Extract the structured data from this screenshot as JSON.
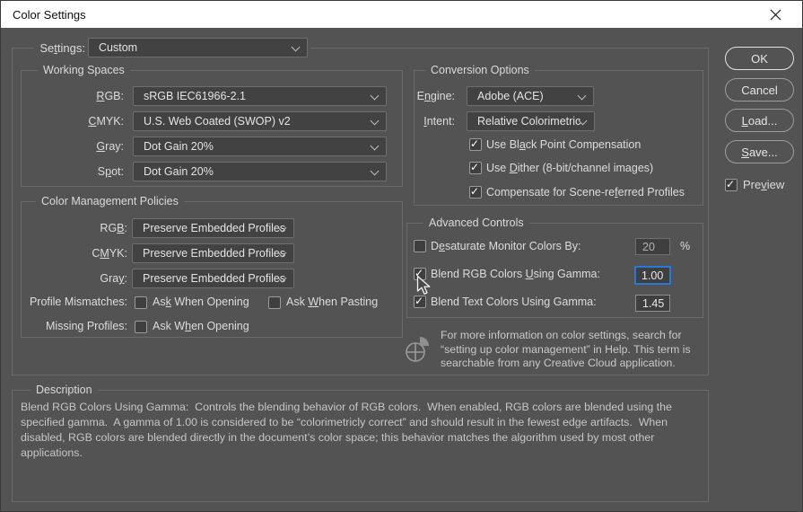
{
  "icons": {
    "check": "✓"
  },
  "colors": {
    "dialog_bg": "#535353",
    "titlebar_bg": "#ffffff",
    "control_bg": "#424242",
    "group_border": "#6a6a6a",
    "focus_accent": "#2878d8",
    "text": "#dcdcdc"
  },
  "window": {
    "title": "Color Settings"
  },
  "settings": {
    "label": {
      "pre": "Se",
      "u": "t",
      "post": "tings:"
    },
    "value": "Custom"
  },
  "working_spaces": {
    "title": "Working Spaces",
    "rows": [
      {
        "label": {
          "pre": "",
          "u": "R",
          "post": "GB:"
        },
        "value": "sRGB IEC61966-2.1"
      },
      {
        "label": {
          "pre": "",
          "u": "C",
          "post": "MYK:"
        },
        "value": "U.S. Web Coated (SWOP) v2"
      },
      {
        "label": {
          "pre": "",
          "u": "G",
          "post": "ray:"
        },
        "value": "Dot Gain 20%"
      },
      {
        "label": {
          "pre": "S",
          "u": "p",
          "post": "ot:"
        },
        "value": "Dot Gain 20%"
      }
    ]
  },
  "policies": {
    "title": "Color Management Policies",
    "rows": [
      {
        "label": {
          "pre": "RG",
          "u": "B",
          "post": ":"
        },
        "value": "Preserve Embedded Profiles"
      },
      {
        "label": {
          "pre": "C",
          "u": "M",
          "post": "YK:"
        },
        "value": "Preserve Embedded Profiles"
      },
      {
        "label": {
          "pre": "Gra",
          "u": "y",
          "post": ":"
        },
        "value": "Preserve Embedded Profiles"
      }
    ],
    "profile_mismatches_label": "Profile Mismatches:",
    "missing_profiles_label": "Missing Profiles:",
    "ask_opening": {
      "pre": "As",
      "u": "k",
      "post": " When Opening",
      "checked": false
    },
    "ask_pasting": {
      "pre": "Ask ",
      "u": "W",
      "post": "hen Pasting",
      "checked": false
    },
    "ask_opening2": {
      "pre": "Ask W",
      "u": "h",
      "post": "en Opening",
      "checked": false
    }
  },
  "conversion": {
    "title": "Conversion Options",
    "engine": {
      "label": {
        "pre": "E",
        "u": "n",
        "post": "gine:"
      },
      "value": "Adobe (ACE)"
    },
    "intent": {
      "label": {
        "pre": "",
        "u": "I",
        "post": "ntent:"
      },
      "value": "Relative Colorimetric"
    },
    "checks": [
      {
        "pre": "Use Bl",
        "u": "a",
        "post": "ck Point Compensation",
        "checked": true
      },
      {
        "pre": "Use ",
        "u": "D",
        "post": "ither (8-bit/channel images)",
        "checked": true
      },
      {
        "pre": "Compensate for Scene-re",
        "u": "f",
        "post": "erred Profiles",
        "checked": true
      }
    ]
  },
  "advanced": {
    "title": "Advanced Controls",
    "rows": [
      {
        "pre": "D",
        "u": "e",
        "post": "saturate Monitor Colors By:",
        "checked": false,
        "value": "20",
        "suffix": "%"
      },
      {
        "pre": "Blend RGB Colors ",
        "u": "U",
        "post": "sing Gamma:",
        "checked": true,
        "value": "1.00"
      },
      {
        "pre": "Blend Text Colors Using Gamma:",
        "u": "",
        "post": "",
        "checked": true,
        "value": "1.45"
      }
    ]
  },
  "info": {
    "text": "For more information on color settings, search for “setting up color management” in Help. This term is searchable from any Creative Cloud application."
  },
  "buttons": {
    "ok": "OK",
    "cancel": "Cancel",
    "load": {
      "pre": "",
      "u": "L",
      "post": "oad..."
    },
    "save": {
      "pre": "",
      "u": "S",
      "post": "ave..."
    },
    "preview": {
      "pre": "Pre",
      "u": "v",
      "post": "iew",
      "checked": true
    }
  },
  "description": {
    "title": "Description",
    "text": "Blend RGB Colors Using Gamma:  Controls the blending behavior of RGB colors.  When enabled, RGB colors are blended using the specified gamma.  A gamma of 1.00 is considered to be “colorimetricly correct” and should result in the fewest edge artifacts.  When disabled, RGB colors are blended directly in the document’s color space; this behavior matches the algorithm used by most other applications."
  }
}
